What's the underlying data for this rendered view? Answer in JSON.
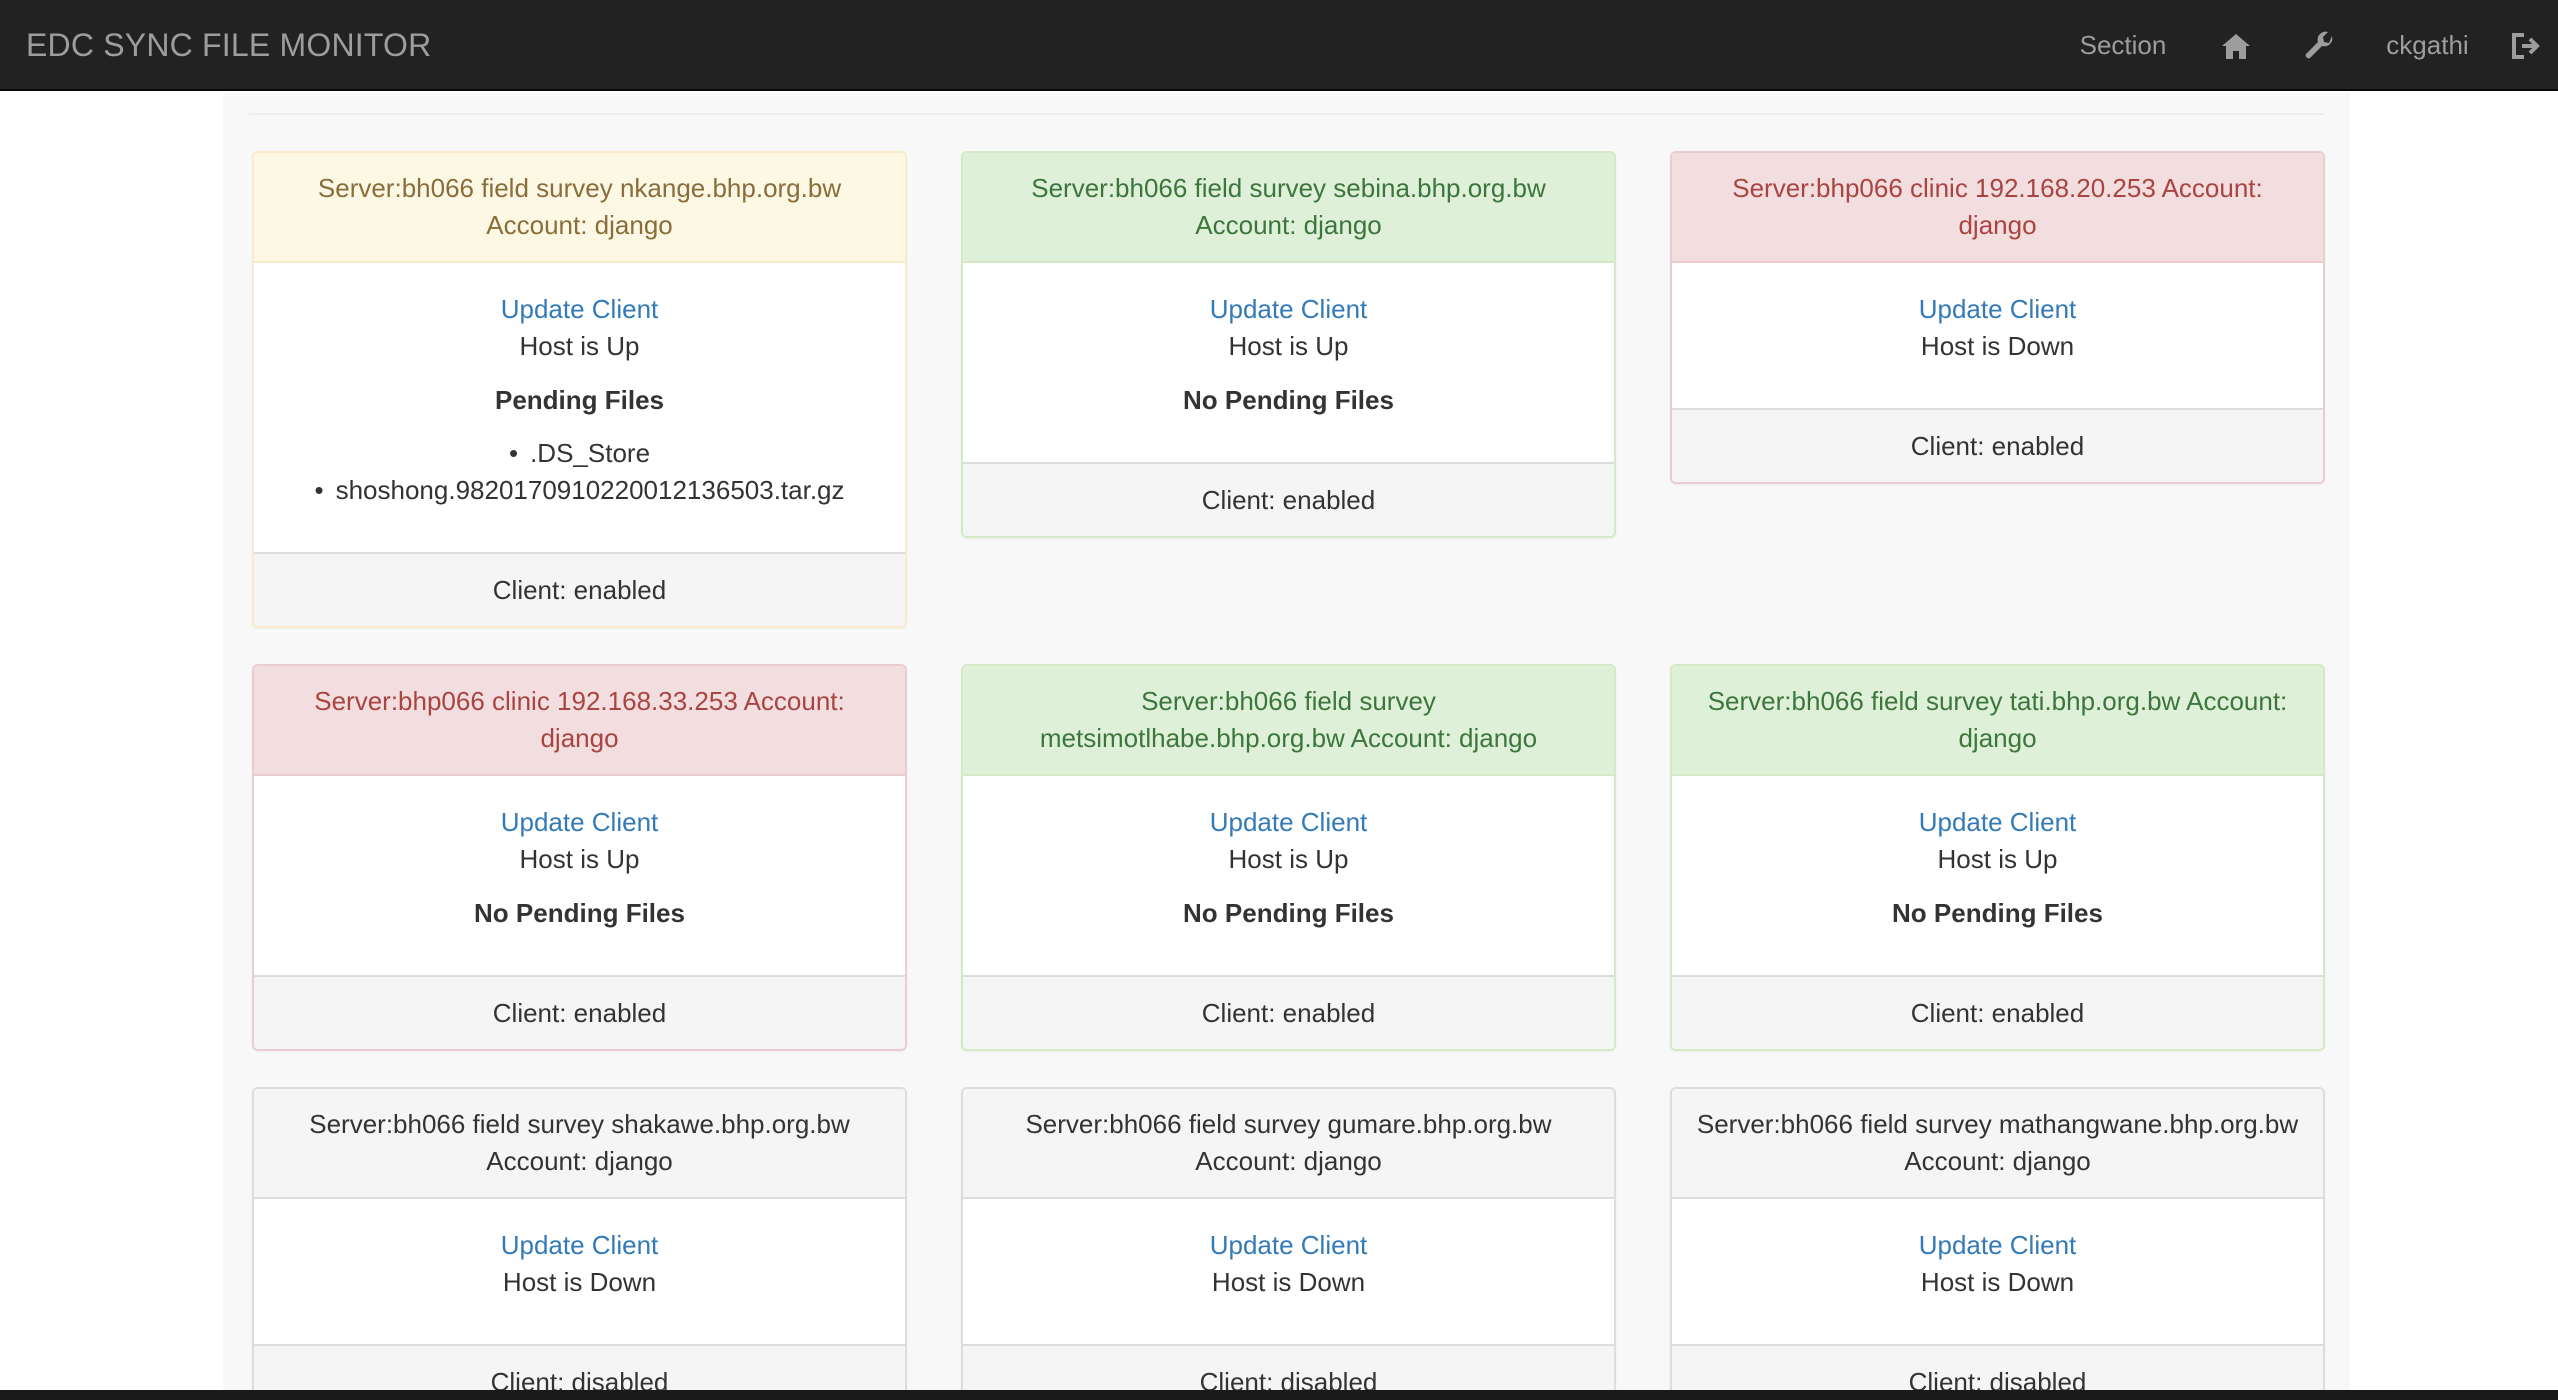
{
  "navbar": {
    "brand": "EDC SYNC FILE MONITOR",
    "section_label": "Section",
    "home_icon": "home-icon",
    "tools_icon": "wrench-icon",
    "username": "ckgathi",
    "logout_icon": "logout-icon"
  },
  "colors": {
    "navbar_bg": "#222222",
    "warning_heading": "#fcf8e3",
    "success_heading": "#dff0d8",
    "danger_heading": "#f2dede",
    "link": "#337ab7"
  },
  "panels": [
    {
      "status": "warning",
      "heading": "Server:bh066 field survey nkange.bhp.org.bw Account: django",
      "update_link": "Update Client",
      "host_status": "Host is Up",
      "pending_title": "Pending Files",
      "pending_files": [
        ".DS_Store",
        "shoshong.98201709102200121365​03.tar.gz"
      ],
      "footer": "Client: enabled"
    },
    {
      "status": "success",
      "heading": "Server:bh066 field survey sebina.bhp.org.bw Account: django",
      "update_link": "Update Client",
      "host_status": "Host is Up",
      "pending_title": "No Pending Files",
      "footer": "Client: enabled"
    },
    {
      "status": "danger",
      "heading": "Server:bhp066 clinic 192.168.20.253 Account: django",
      "update_link": "Update Client",
      "host_status": "Host is Down",
      "footer": "Client: enabled"
    },
    {
      "status": "danger",
      "heading": "Server:bhp066 clinic 192.168.33.253 Account: django",
      "update_link": "Update Client",
      "host_status": "Host is Up",
      "pending_title": "No Pending Files",
      "footer": "Client: enabled"
    },
    {
      "status": "success",
      "heading": "Server:bh066 field survey metsimotlhabe.bhp.org.bw Account: django",
      "update_link": "Update Client",
      "host_status": "Host is Up",
      "pending_title": "No Pending Files",
      "footer": "Client: enabled"
    },
    {
      "status": "success",
      "heading": "Server:bh066 field survey tati.bhp.org.bw Account: django",
      "update_link": "Update Client",
      "host_status": "Host is Up",
      "pending_title": "No Pending Files",
      "footer": "Client: enabled"
    },
    {
      "status": "default",
      "heading": "Server:bh066 field survey shakawe.bhp.org.bw Account: django",
      "update_link": "Update Client",
      "host_status": "Host is Down",
      "footer": "Client: disabled"
    },
    {
      "status": "default",
      "heading": "Server:bh066 field survey gumare.bhp.org.bw Account: django",
      "update_link": "Update Client",
      "host_status": "Host is Down",
      "footer": "Client: disabled"
    },
    {
      "status": "default",
      "heading": "Server:bh066 field survey mathangwane.bhp.org.bw Account: django",
      "update_link": "Update Client",
      "host_status": "Host is Down",
      "footer": "Client: disabled"
    }
  ]
}
